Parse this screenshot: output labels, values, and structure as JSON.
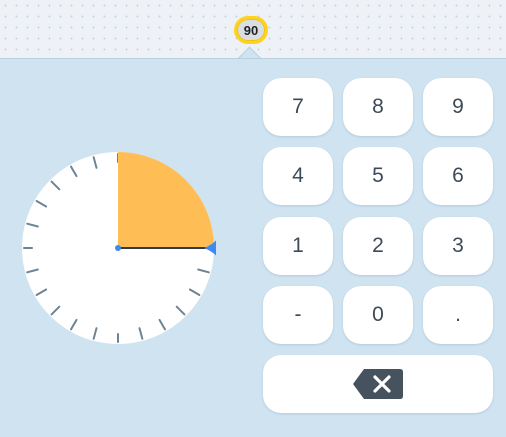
{
  "editor": {
    "value": "90",
    "angle_degrees": 90,
    "colors": {
      "panel_bg": "#cfe3f1",
      "sector_fill": "#ffbe55",
      "handle": "#3d8bf2",
      "tick": "#6e8494",
      "value_border": "#ffd21f"
    }
  },
  "keypad": {
    "rows": [
      [
        "7",
        "8",
        "9"
      ],
      [
        "4",
        "5",
        "6"
      ],
      [
        "1",
        "2",
        "3"
      ],
      [
        "-",
        "0",
        "."
      ]
    ],
    "backspace_icon": "backspace-icon"
  }
}
